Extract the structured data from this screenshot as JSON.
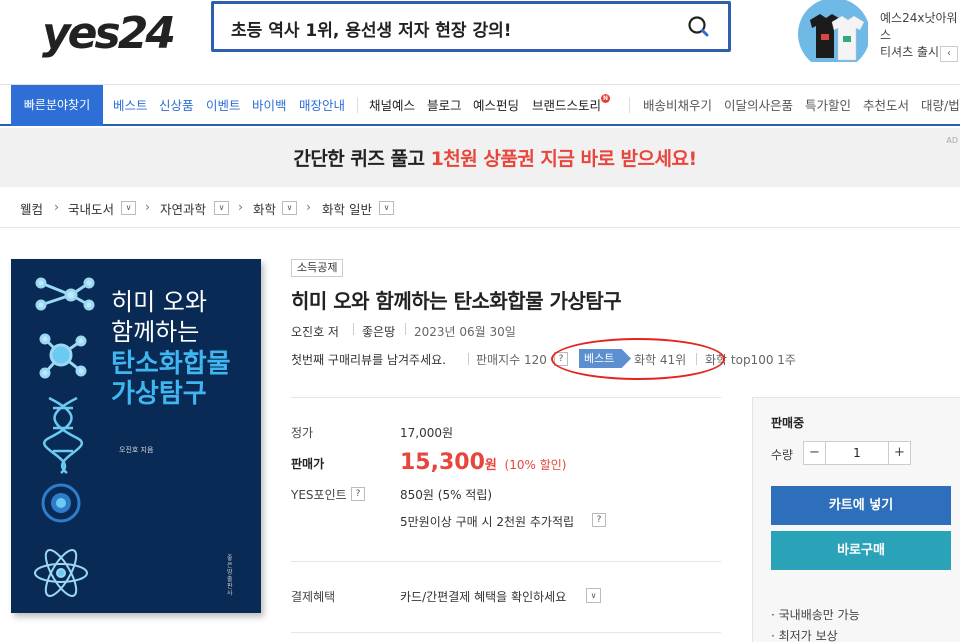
{
  "header": {
    "logo": "yes24",
    "search_value": "초등 역사 1위, 용선생 저자 현장 강의!",
    "ad_line1": "예스24x낫아워스",
    "ad_line2": "티셔츠 출시!"
  },
  "nav": {
    "quick": "빠른분야찾기",
    "blue_items": [
      "베스트",
      "신상품",
      "이벤트",
      "바이백",
      "매장안내"
    ],
    "dark_items": [
      "채널예스",
      "블로그",
      "예스펀딩",
      "브랜드스토리"
    ],
    "gray_items": [
      "배송비채우기",
      "이달의사은품",
      "특가할인",
      "추천도서",
      "대량/법"
    ],
    "badge": "N"
  },
  "promo": {
    "text_a": "간단한 퀴즈 풀고 ",
    "text_b": "1천원 상품권 지금 바로 받으세요!",
    "ad_label": "AD"
  },
  "breadcrumb": {
    "home": "웰컴",
    "items": [
      "국내도서",
      "자연과학",
      "화학",
      "화학 일반"
    ]
  },
  "cover": {
    "title_line1": "히미 오와",
    "title_line2": "함께하는",
    "title_line3": "탄소화합물",
    "title_line4": "가상탐구",
    "author": "오진호 지음",
    "publisher": "좋은땅 출판사"
  },
  "product": {
    "tag": "소득공제",
    "title": "히미 오와 함께하는 탄소화합물 가상탐구",
    "author": "오진호 저",
    "publisher": "좋은땅",
    "date": "2023년 06월 30일",
    "review_prompt": "첫번째 구매리뷰를 남겨주세요.",
    "sales_index": "판매지수 120",
    "best_label": "베스트",
    "rank": "화학 41위",
    "top100": "화학 top100 1주"
  },
  "price": {
    "list_label": "정가",
    "list_value": "17,000원",
    "sale_label": "판매가",
    "sale_value": "15,300",
    "sale_unit": "원",
    "sale_discount": "(10% 할인)",
    "points_label": "YES포인트",
    "points_value": "850원 (5% 적립)",
    "points_extra": "5만원이상 구매 시 2천원 추가적립",
    "benefit_label": "결제혜택",
    "benefit_value": "카드/간편결제 혜택을 확인하세요"
  },
  "side": {
    "status": "판매중",
    "qty_label": "수량",
    "qty_value": "1",
    "minus": "−",
    "plus": "+",
    "cart_button": "카트에 넣기",
    "buy_button": "바로구매",
    "note1": "· 국내배송만 가능",
    "note2": "· 최저가 보상"
  },
  "colors": {
    "brand_blue": "#2d6fd6",
    "sale_red": "#e8453c",
    "cover_navy": "#082a55",
    "cart_blue": "#2d6fba",
    "buy_teal": "#2aa3b8"
  }
}
